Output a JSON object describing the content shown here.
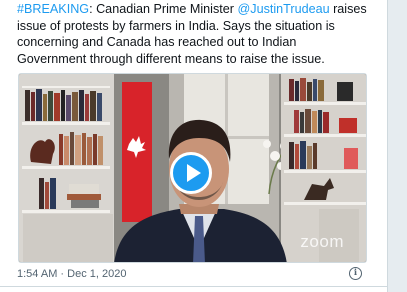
{
  "tweet": {
    "hashtag": "#BREAKING",
    "text_part1": ": Canadian Prime Minister ",
    "mention": "@JustinTrudeau",
    "text_part2": " raises issue of protests by farmers in India. Says the situation is concerning and Canada has reached out to Indian Government through different means to raise the issue.",
    "time": "1:54 AM",
    "separator": " · ",
    "date": "Dec 1, 2020",
    "info_glyph": "i"
  },
  "video": {
    "watermark": "zoom",
    "play_icon": "play-icon",
    "accent_color": "#1d9bf0"
  }
}
